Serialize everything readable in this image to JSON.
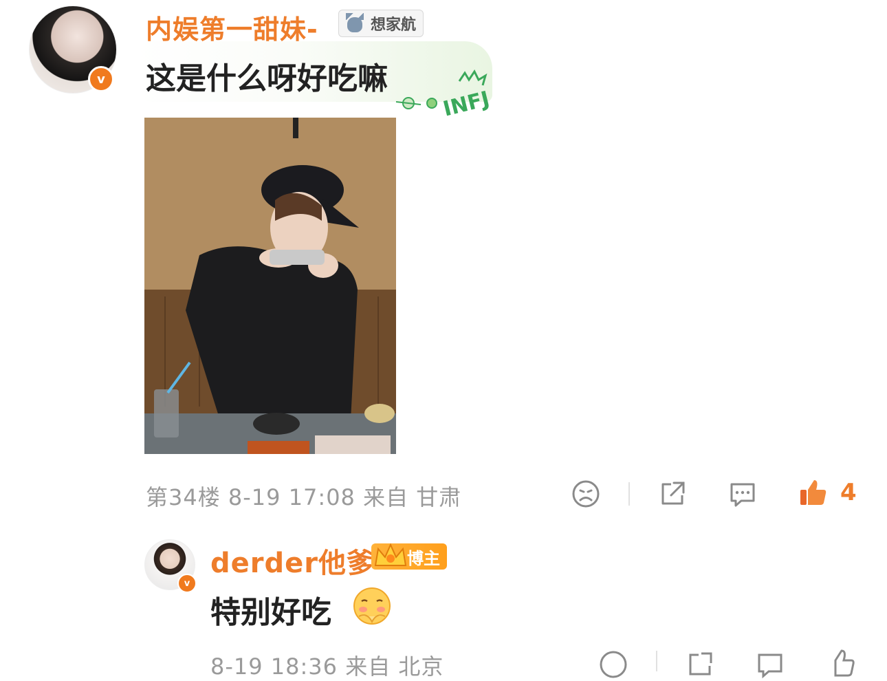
{
  "main_comment": {
    "username": "内娱第一甜妹-",
    "tag_label": "想家航",
    "text": "这是什么呀好吃嘛",
    "sticker_text": "INFJ",
    "meta": "第34楼 8-19 17:08 来自 甘肃",
    "like_count": "4"
  },
  "reply": {
    "username": "derder他爹",
    "role_badge": "博主",
    "text": "特别好吃",
    "meta": "8-19 18:36 来自 北京"
  },
  "colors": {
    "username": "#ee7d2b",
    "meta": "#9a9a9a",
    "like_active": "#ee7d2b",
    "verified": "#f07a1e"
  }
}
